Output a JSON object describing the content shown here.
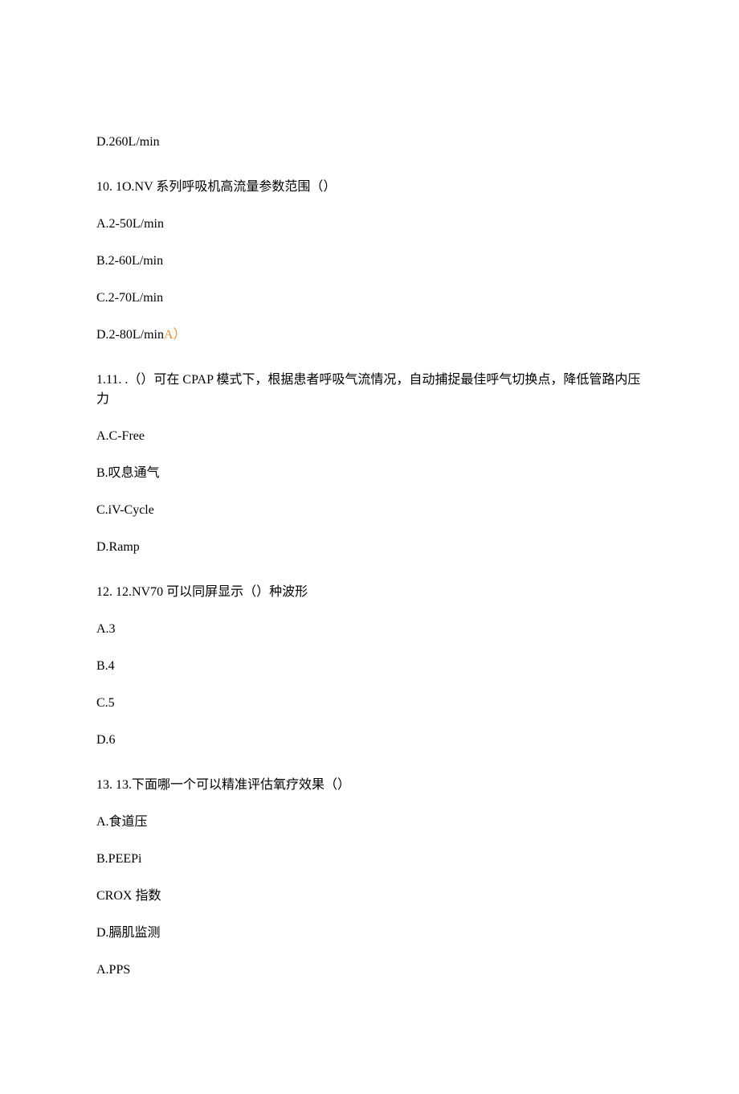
{
  "lines": {
    "l1": "D.260L/min",
    "l2": "10.   1O.NV 系列呼吸机高流量参数范围（）",
    "l3": "A.2-50L/min",
    "l4": "B.2-60L/min",
    "l5": "C.2-70L/min",
    "l6a": "D.2-80L/min",
    "l6b": "A）",
    "l7": "1.11.     .（）可在 CPAP 模式下，根据患者呼吸气流情况，自动捕捉最佳呼气切换点，降低管路内压力",
    "l8": "A.C-Free",
    "l9": "B.叹息通气",
    "l10": "C.iV-Cycle",
    "l11": "D.Ramp",
    "l12": "12.   12.NV70 可以同屏显示（）种波形",
    "l13": "A.3",
    "l14": "B.4",
    "l15": "C.5",
    "l16": "D.6",
    "l17": "13.   13.下面哪一个可以精准评估氧疗效果（）",
    "l18": "A.食道压",
    "l19": "B.PEEPi",
    "l20": "CROX 指数",
    "l21": "D.膈肌监测",
    "l22": "A.PPS"
  }
}
